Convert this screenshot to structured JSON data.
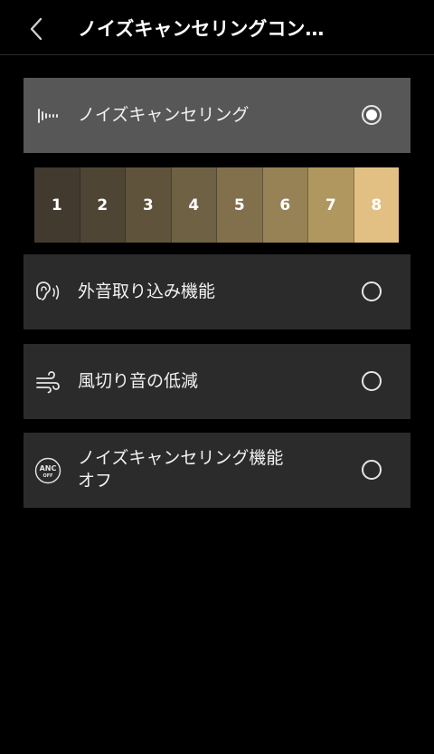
{
  "header": {
    "title": "ノイズキャンセリングコン…",
    "back_icon": "chevron-left-icon"
  },
  "modes": [
    {
      "label": "ノイズキャンセリング",
      "icon": "noise-cancel-icon",
      "selected": true
    },
    {
      "label": "外音取り込み機能",
      "icon": "ambient-ear-icon",
      "selected": false
    },
    {
      "label": "風切り音の低減",
      "icon": "wind-icon",
      "selected": false
    },
    {
      "label_line1": "ノイズキャンセリング機能",
      "label_line2": "オフ",
      "icon": "anc-off-icon",
      "icon_text_top": "ANC",
      "icon_text_bottom": "OFF",
      "selected": false
    }
  ],
  "levels": {
    "items": [
      "1",
      "2",
      "3",
      "4",
      "5",
      "6",
      "7",
      "8"
    ],
    "selected": "8",
    "colors": [
      "#423a2e",
      "#4f4535",
      "#5f533c",
      "#6f6144",
      "#82704c",
      "#978255",
      "#af975f",
      "#e2c083"
    ]
  },
  "colors": {
    "background": "#000000",
    "option_bg": "#2b2b2b",
    "option_selected_bg": "#575757"
  }
}
